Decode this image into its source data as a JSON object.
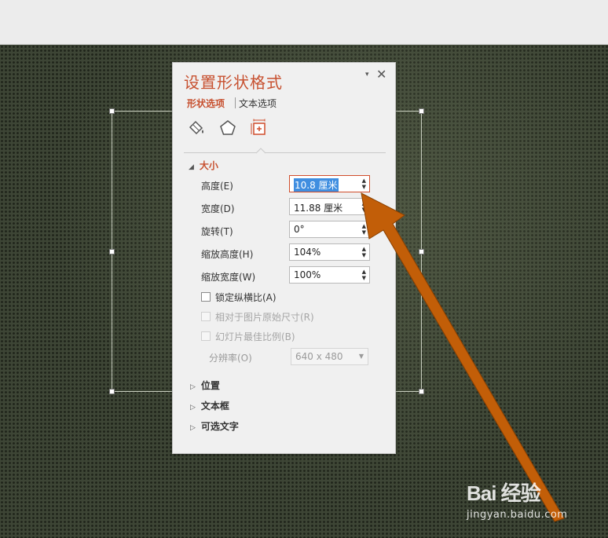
{
  "panel": {
    "title": "设置形状格式",
    "pin_glyph": "▾",
    "close_glyph": "✕",
    "tabs": [
      {
        "label": "形状选项",
        "active": true
      },
      {
        "label": "文本选项",
        "active": false
      }
    ],
    "icons": [
      "fill-bucket-icon",
      "pentagon-icon",
      "size-properties-icon"
    ]
  },
  "size_section": {
    "title": "大小",
    "expanded": true,
    "rows": [
      {
        "label": "高度(E)",
        "value": "10.8 厘米",
        "highlighted": true
      },
      {
        "label": "宽度(D)",
        "value": "11.88 厘米"
      },
      {
        "label": "旋转(T)",
        "value": "0°"
      },
      {
        "label": "缩放高度(H)",
        "value": "104%"
      },
      {
        "label": "缩放宽度(W)",
        "value": "100%"
      }
    ],
    "checkboxes": [
      {
        "label": "锁定纵横比(A)",
        "checked": false,
        "enabled": true
      },
      {
        "label": "相对于图片原始尺寸(R)",
        "checked": false,
        "enabled": false
      },
      {
        "label": "幻灯片最佳比例(B)",
        "checked": false,
        "enabled": false
      }
    ],
    "resolution": {
      "label": "分辨率(O)",
      "value": "640 x 480",
      "enabled": false
    }
  },
  "collapsed_sections": [
    "位置",
    "文本框",
    "可选文字"
  ],
  "watermark": {
    "logo": "Bai 经验",
    "url": "jingyan.baidu.com"
  },
  "colors": {
    "accent": "#c7502f",
    "arrow": "#c25e08",
    "selection": "#3f8ee0"
  }
}
